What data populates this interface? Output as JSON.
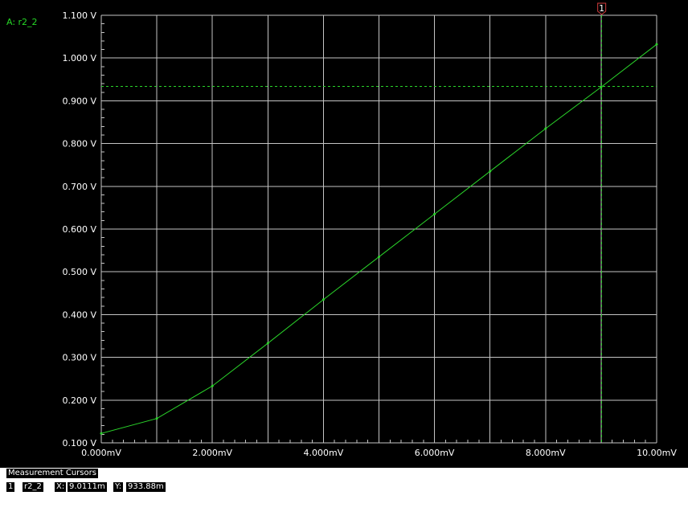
{
  "trace_label": "A: r2_2",
  "cursor_marker": "1",
  "measurement_panel": {
    "title": "Measurement Cursors",
    "cursor_id": "1",
    "trace": "r2_2",
    "x_label": "X:",
    "x_value": "9.0111m",
    "y_label": "Y:",
    "y_value": "933.88m"
  },
  "colors": {
    "background": "#000000",
    "grid": "#c4c4c4",
    "trace": "#2ad42a",
    "cursor": "#2ad42a",
    "labels": "#ffffff"
  },
  "chart_data": {
    "type": "line",
    "xlim": [
      0,
      10
    ],
    "ylim": [
      0.1,
      1.1
    ],
    "x_unit": "mV",
    "y_unit": "V",
    "x_ticks": [
      "0.000mV",
      "2.000mV",
      "4.000mV",
      "6.000mV",
      "8.000mV",
      "10.00mV"
    ],
    "y_ticks": [
      "0.100 V",
      "0.200 V",
      "0.300 V",
      "0.400 V",
      "0.500 V",
      "0.600 V",
      "0.700 V",
      "0.800 V",
      "0.900 V",
      "1.000 V",
      "1.100 V"
    ],
    "grid": true,
    "series": [
      {
        "name": "r2_2",
        "x": [
          0,
          1,
          2,
          3,
          4,
          5,
          6,
          7,
          8,
          9,
          10
        ],
        "y": [
          0.122,
          0.157,
          0.233,
          0.333,
          0.435,
          0.535,
          0.635,
          0.735,
          0.835,
          0.932,
          1.032
        ]
      }
    ],
    "cursor": {
      "id": "1",
      "x": 9.0111,
      "y": 0.93388
    }
  }
}
